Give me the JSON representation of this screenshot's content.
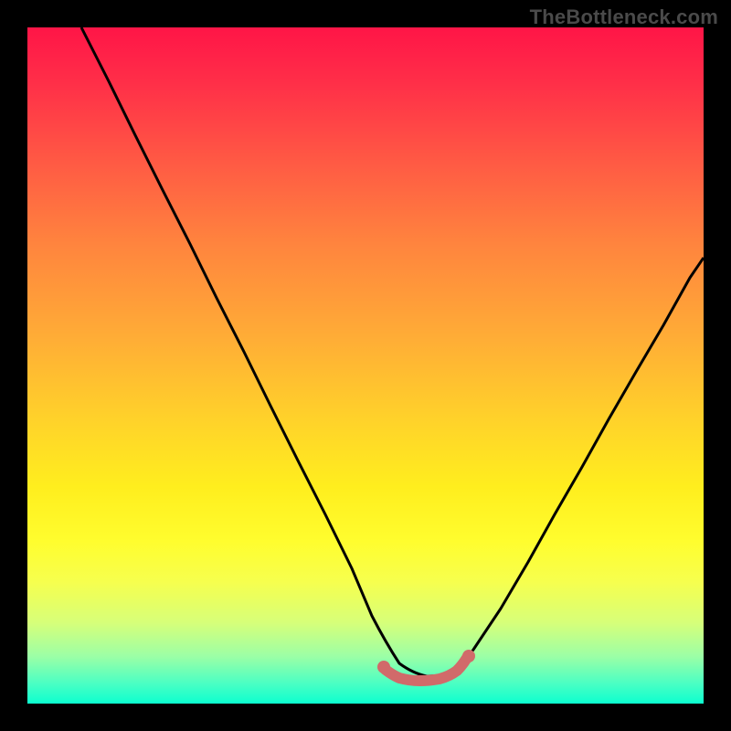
{
  "watermark": "TheBottleneck.com",
  "chart_data": {
    "type": "line",
    "title": "",
    "xlabel": "",
    "ylabel": "",
    "xlim": [
      0,
      100
    ],
    "ylim": [
      0,
      100
    ],
    "series": [
      {
        "name": "bottleneck-curve",
        "x": [
          8,
          12,
          16,
          20,
          24,
          28,
          32,
          36,
          40,
          44,
          48,
          51,
          53,
          55,
          57,
          59,
          61,
          63,
          64,
          66,
          70,
          74,
          78,
          82,
          86,
          90,
          94,
          98,
          100
        ],
        "y": [
          100,
          92,
          84,
          76,
          68,
          60,
          52,
          44,
          36,
          28,
          20,
          13,
          9,
          6,
          4.5,
          4,
          4,
          4.5,
          5.5,
          8,
          14,
          21,
          28,
          35,
          42,
          49,
          56,
          63,
          66
        ]
      },
      {
        "name": "optimal-zone-marker",
        "x": [
          53,
          54,
          55,
          56,
          57,
          58,
          59,
          60,
          61,
          62,
          63,
          64
        ],
        "y": [
          5,
          4.2,
          3.8,
          3.6,
          3.5,
          3.5,
          3.5,
          3.6,
          3.8,
          4.2,
          5,
          6
        ]
      }
    ],
    "colors": {
      "curve": "#000000",
      "marker": "#d16a6a",
      "gradient_top": "#ff1547",
      "gradient_mid": "#ffee1e",
      "gradient_bottom": "#0cffcf"
    }
  }
}
